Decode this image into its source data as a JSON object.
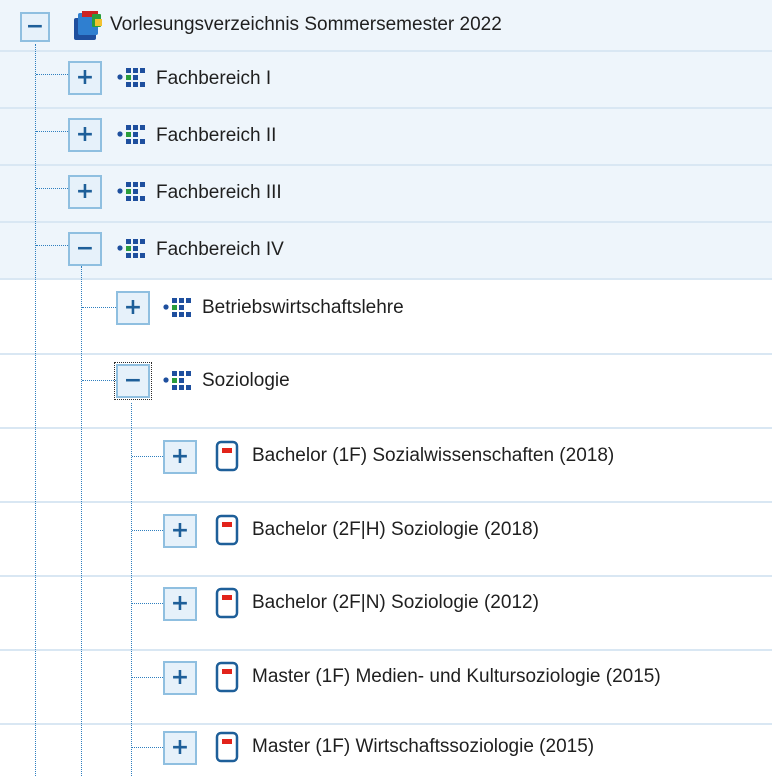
{
  "tree": {
    "root": {
      "label": "Vorlesungsverzeichnis Sommersemester 2022",
      "toggle": "−",
      "icon": "books-icon"
    },
    "level1": [
      {
        "label": "Fachbereich I",
        "toggle": "+",
        "icon": "org-units-icon"
      },
      {
        "label": "Fachbereich II",
        "toggle": "+",
        "icon": "org-units-icon"
      },
      {
        "label": "Fachbereich III",
        "toggle": "+",
        "icon": "org-units-icon"
      },
      {
        "label": "Fachbereich IV",
        "toggle": "−",
        "icon": "org-units-icon"
      }
    ],
    "level2": [
      {
        "label": "Betriebswirtschaftslehre",
        "toggle": "+",
        "icon": "org-units-icon"
      },
      {
        "label": "Soziologie",
        "toggle": "−",
        "icon": "org-units-icon"
      }
    ],
    "level3": [
      {
        "label": "Bachelor (1F) Sozialwissenschaften (2018)",
        "toggle": "+",
        "icon": "study-program-icon"
      },
      {
        "label": "Bachelor (2F|H) Soziologie (2018)",
        "toggle": "+",
        "icon": "study-program-icon"
      },
      {
        "label": "Bachelor (2F|N) Soziologie (2012)",
        "toggle": "+",
        "icon": "study-program-icon"
      },
      {
        "label": "Master (1F) Medien- und Kultursoziologie (2015)",
        "toggle": "+",
        "icon": "study-program-icon"
      },
      {
        "label": "Master (1F) Wirtschaftssoziologie (2015)",
        "toggle": "+",
        "icon": "study-program-icon"
      }
    ]
  },
  "colors": {
    "row_band": "#eef5fb",
    "separator": "#d9e7f3",
    "toggle_border": "#8fbfe0",
    "toggle_glyph": "#1e5f99",
    "tree_line": "#2f7fbf"
  }
}
